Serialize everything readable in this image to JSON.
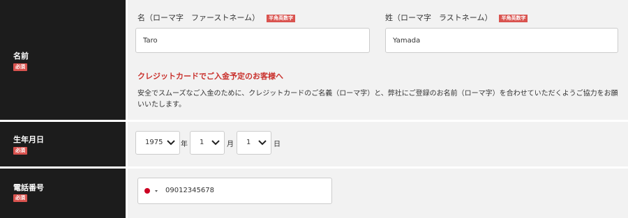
{
  "name_row": {
    "label": "名前",
    "required": "必須",
    "first_name": {
      "label": "名（ローマ字　ファーストネーム）",
      "badge": "半角英数字",
      "value": "Taro"
    },
    "last_name": {
      "label": "姓（ローマ字　ラストネーム）",
      "badge": "半角英数字",
      "value": "Yamada"
    },
    "notice_title": "クレジットカードでご入金予定のお客様へ",
    "notice_text": "安全でスムーズなご入金のために、クレジットカードのご名義（ローマ字）と、弊社にご登録のお名前（ローマ字）を合わせていただくようご協力をお願いいたします。"
  },
  "birthday_row": {
    "label": "生年月日",
    "required": "必須",
    "year": {
      "value": "1975",
      "unit": "年"
    },
    "month": {
      "value": "1",
      "unit": "月"
    },
    "day": {
      "value": "1",
      "unit": "日"
    }
  },
  "phone_row": {
    "label": "電話番号",
    "required": "必須",
    "country_flag": "japan-flag-icon",
    "value": "09012345678"
  },
  "colors": {
    "label_bg": "#1c1c1c",
    "content_bg": "#f2f2f2",
    "badge": "#d9534f",
    "notice": "#c9302c"
  }
}
